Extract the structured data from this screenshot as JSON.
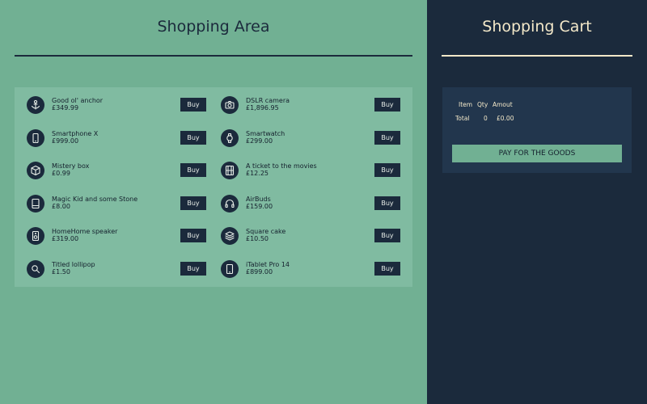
{
  "shop": {
    "title": "Shopping Area",
    "buy_label": "Buy",
    "products": [
      {
        "name": "Good ol' anchor",
        "price": "£349.99",
        "icon": "anchor-icon"
      },
      {
        "name": "DSLR camera",
        "price": "£1,896.95",
        "icon": "camera-icon"
      },
      {
        "name": "Smartphone X",
        "price": "£999.00",
        "icon": "smartphone-icon"
      },
      {
        "name": "Smartwatch",
        "price": "£299.00",
        "icon": "watch-icon"
      },
      {
        "name": "Mistery box",
        "price": "£0.99",
        "icon": "box-icon"
      },
      {
        "name": "A ticket to the movies",
        "price": "£12.25",
        "icon": "film-icon"
      },
      {
        "name": "Magic Kid and some Stone",
        "price": "£8.00",
        "icon": "book-icon"
      },
      {
        "name": "AirBuds",
        "price": "£159.00",
        "icon": "headphones-icon"
      },
      {
        "name": "HomeHome speaker",
        "price": "£319.00",
        "icon": "speaker-icon"
      },
      {
        "name": "Square cake",
        "price": "£10.50",
        "icon": "layers-icon"
      },
      {
        "name": "Titled lollipop",
        "price": "£1.50",
        "icon": "search-icon"
      },
      {
        "name": "iTablet Pro 14",
        "price": "£899.00",
        "icon": "tablet-icon"
      }
    ]
  },
  "cart": {
    "title": "Shopping Cart",
    "headers": {
      "item": "Item",
      "qty": "Qty",
      "amount": "Amout"
    },
    "total": {
      "label": "Total",
      "qty": "0",
      "amount": "£0.00"
    },
    "pay_label": "PAY FOR THE GOODS"
  },
  "colors": {
    "shop_bg": "#71b093",
    "panel_bg": "#80bba1",
    "navy": "#1b2a3c",
    "cart_panel_bg": "#22364d",
    "cream": "#f3e8c9"
  }
}
